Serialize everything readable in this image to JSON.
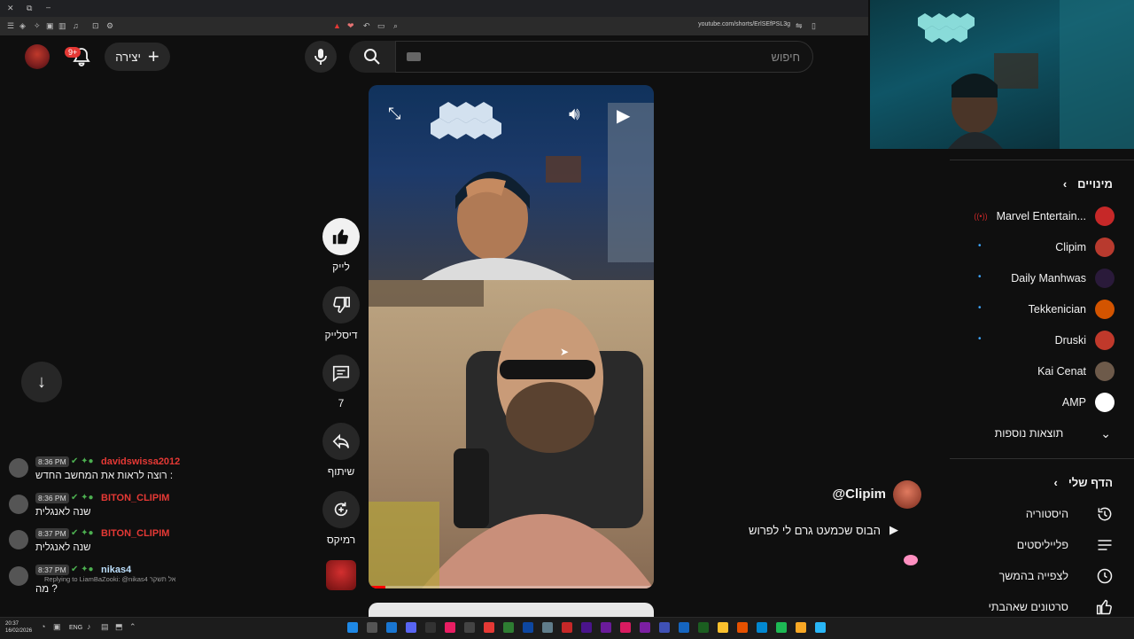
{
  "browser": {
    "url": "youtube.com/shorts/ErlSEfPSL3g"
  },
  "topbar": {
    "notification_badge": "9+",
    "create_label": "יצירה",
    "search_placeholder": "חיפוש"
  },
  "actions": {
    "like_label": "לייק",
    "dislike_label": "דיסלייק",
    "comments_count": "7",
    "share_label": "שיתוף",
    "remix_label": "רמיקס"
  },
  "video": {
    "channel": "@Clipim",
    "title": "הבוס שכמעט גרם לי לפרוש",
    "progress": 0.06
  },
  "sidebar": {
    "subs_header": "מינויים",
    "subscriptions": [
      {
        "name": "Marvel Entertain...",
        "new": false,
        "live": true,
        "color": "#c62828"
      },
      {
        "name": "Clipim",
        "new": true,
        "live": false,
        "color": "#b83a2e"
      },
      {
        "name": "Daily Manhwas",
        "new": true,
        "live": false,
        "color": "#2a1a3a"
      },
      {
        "name": "Tekkenician",
        "new": true,
        "live": false,
        "color": "#d35400"
      },
      {
        "name": "Druski",
        "new": true,
        "live": false,
        "color": "#c0392b"
      },
      {
        "name": "Kai Cenat",
        "new": false,
        "live": false,
        "color": "#6d5a4a"
      },
      {
        "name": "AMP",
        "new": false,
        "live": false,
        "color": "#ffffff"
      }
    ],
    "more_label": "תוצאות נוספות",
    "you_header": "הדף שלי",
    "you_items": [
      {
        "label": "היסטוריה",
        "icon": "history-icon"
      },
      {
        "label": "פלייליסטים",
        "icon": "playlists-icon"
      },
      {
        "label": "לצפייה בהמשך",
        "icon": "watch-later-icon"
      },
      {
        "label": "סרטונים שאהבתי",
        "icon": "liked-videos-icon"
      }
    ]
  },
  "chat": {
    "messages": [
      {
        "time": "8:36 PM",
        "user": "davidswissa2012",
        "user_color": "#e53935",
        "text": "רוצה לראות את המחשב החדש :",
        "reply": ""
      },
      {
        "time": "8:36 PM",
        "user": "BITON_CLIPIM",
        "user_color": "#e53935",
        "text": "שנה לאנגלית",
        "reply": ""
      },
      {
        "time": "8:37 PM",
        "user": "BITON_CLIPIM",
        "user_color": "#e53935",
        "text": "שנה לאנגלית",
        "reply": ""
      },
      {
        "time": "8:37 PM",
        "user": "nikas4",
        "user_color": "#bbdefb",
        "text": "מה ?",
        "reply": "Replying to LiamBaZooki: @nikas4 אל תשקר"
      }
    ]
  },
  "taskbar": {
    "time": "20:37",
    "date": "16/02/2026",
    "lang": "ENG"
  }
}
